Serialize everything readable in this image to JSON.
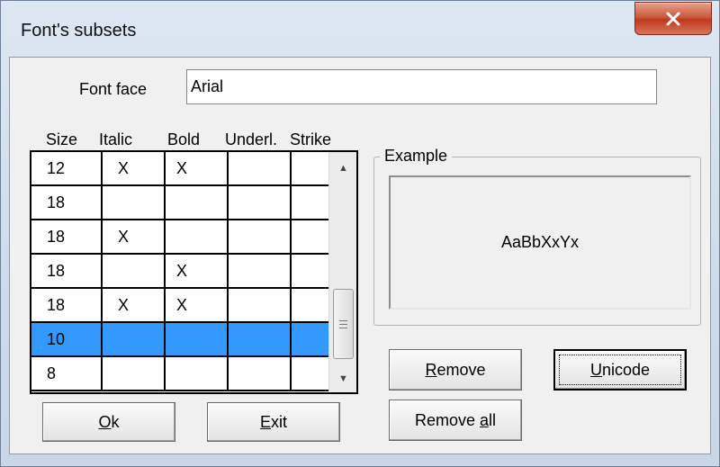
{
  "window": {
    "title": "Font's subsets"
  },
  "form": {
    "font_face_label": "Font face",
    "font_face_value": "Arial"
  },
  "grid": {
    "columns": [
      "Size",
      "Italic",
      "Bold",
      "Underl.",
      "Strike"
    ],
    "rows": [
      {
        "size": "12",
        "italic": "X",
        "bold": "X",
        "underline": "",
        "strike": "",
        "selected": false
      },
      {
        "size": "18",
        "italic": "",
        "bold": "",
        "underline": "",
        "strike": "",
        "selected": false
      },
      {
        "size": "18",
        "italic": "X",
        "bold": "",
        "underline": "",
        "strike": "",
        "selected": false
      },
      {
        "size": "18",
        "italic": "",
        "bold": "X",
        "underline": "",
        "strike": "",
        "selected": false
      },
      {
        "size": "18",
        "italic": "X",
        "bold": "X",
        "underline": "",
        "strike": "",
        "selected": false
      },
      {
        "size": "10",
        "italic": "",
        "bold": "",
        "underline": "",
        "strike": "",
        "selected": true
      },
      {
        "size": "8",
        "italic": "",
        "bold": "",
        "underline": "",
        "strike": "",
        "selected": false
      }
    ]
  },
  "example": {
    "label": "Example",
    "sample": "AaBbXxYx"
  },
  "buttons": {
    "ok": {
      "accel": "O",
      "rest": "k"
    },
    "exit": {
      "accel": "E",
      "rest": "xit"
    },
    "remove": {
      "accel": "R",
      "rest": "emove"
    },
    "remove_all": {
      "pre": "Remove ",
      "accel": "a",
      "rest": "ll"
    },
    "unicode": {
      "accel": "U",
      "rest": "nicode"
    }
  },
  "icons": {
    "close": "close-icon",
    "scroll_up": "scroll-up-arrow-icon",
    "scroll_down": "scroll-down-arrow-icon",
    "thumb_grip": "grip-icon"
  },
  "colors": {
    "selection": "#3399ff",
    "close_button": "#c0391f",
    "client_bg": "#f0f0f0"
  }
}
